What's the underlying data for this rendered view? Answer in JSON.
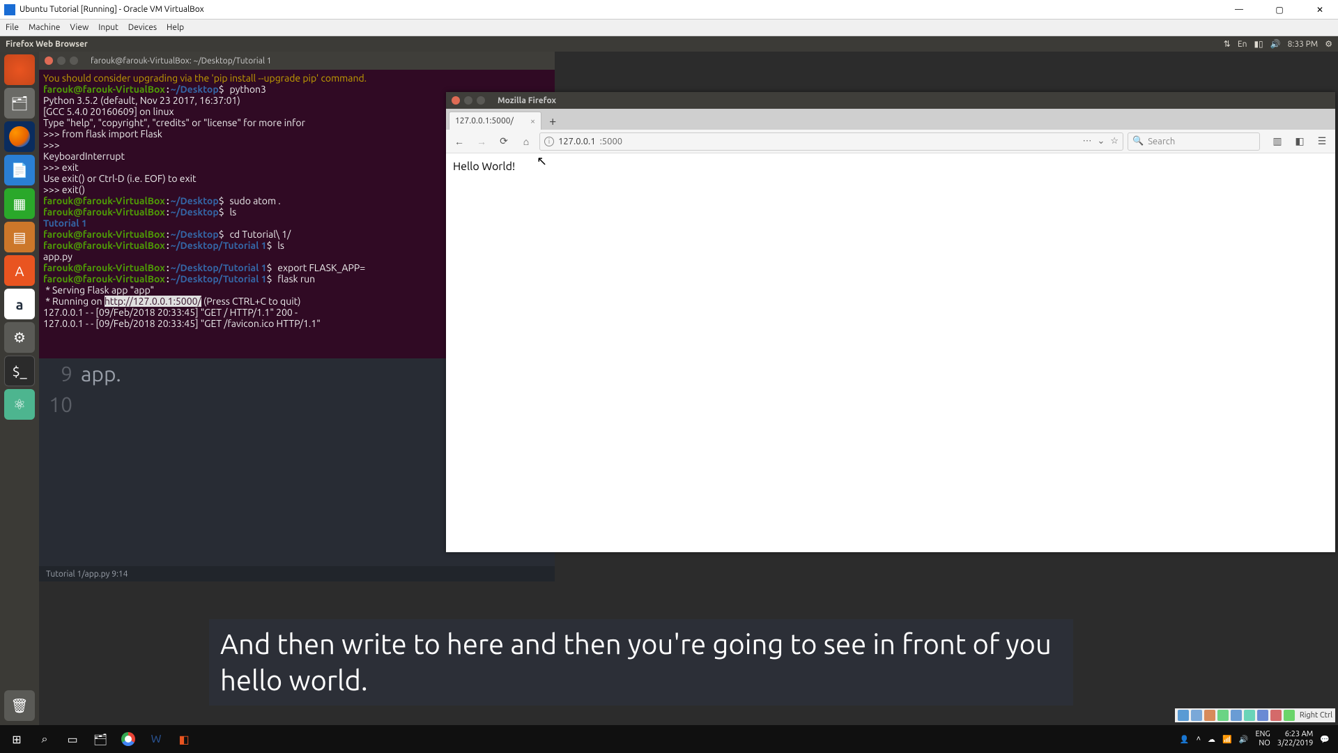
{
  "vbox": {
    "title": "Ubuntu Tutorial [Running] - Oracle VM VirtualBox",
    "menu": [
      "File",
      "Machine",
      "View",
      "Input",
      "Devices",
      "Help"
    ],
    "rightctrl": "Right Ctrl"
  },
  "ubuntu_topbar": {
    "left": "Firefox Web Browser",
    "lang": "En",
    "time": "8:33 PM"
  },
  "terminal": {
    "title": "farouk@farouk-VirtualBox: ~/Desktop/Tutorial 1",
    "warn": "You should consider upgrading via the 'pip install --upgrade pip' command.",
    "prompt_user": "farouk@farouk-VirtualBox",
    "l1_path": "~/Desktop",
    "l1_cmd": "python3",
    "py1": "Python 3.5.2 (default, Nov 23 2017, 16:37:01)",
    "py2": "[GCC 5.4.0 20160609] on linux",
    "py3": "Type \"help\", \"copyright\", \"credits\" or \"license\" for more infor",
    "py4": ">>> from flask import Flask",
    "py5": ">>>",
    "py6": "KeyboardInterrupt",
    "py7": ">>> exit",
    "py8": "Use exit() or Ctrl-D (i.e. EOF) to exit",
    "py9": ">>> exit()",
    "l2_cmd": "sudo atom .",
    "l3_cmd": "ls",
    "l3_out": "Tutorial 1",
    "l4_cmd": "cd Tutorial\\ 1/",
    "tut_path": "~/Desktop/Tutorial 1",
    "l5_cmd": "ls",
    "l5_out": "app.py",
    "l6_cmd": "export FLASK_APP=",
    "l7_cmd": "flask run",
    "l7_out1": " * Serving Flask app \"app\"",
    "l7_out2_pre": " * Running on ",
    "l7_out2_url": "http://127.0.0.1:5000/",
    "l7_out2_post": " (Press CTRL+C to quit)",
    "log1": "127.0.0.1 - - [09/Feb/2018 20:33:45] \"GET / HTTP/1.1\" 200 -",
    "log2": "127.0.0.1 - - [09/Feb/2018 20:33:45] \"GET /favicon.ico HTTP/1.1\""
  },
  "atom": {
    "line9_num": "9",
    "line9_code": "app.",
    "line10_num": "10",
    "status": "Tutorial 1/app.py    9:14"
  },
  "firefox": {
    "title": "Mozilla Firefox",
    "tab_label": "127.0.0.1:5000/",
    "url_host": "127.0.0.1",
    "url_port": ":5000",
    "search_placeholder": "Search",
    "page_text": "Hello World!"
  },
  "subtitle": {
    "line1": "And then write to here and then you're going to see in front of you",
    "line2": "hello world."
  },
  "windows": {
    "lang1": "ENG",
    "lang2": "NO",
    "time": "6:23 AM",
    "date": "3/22/2019"
  }
}
